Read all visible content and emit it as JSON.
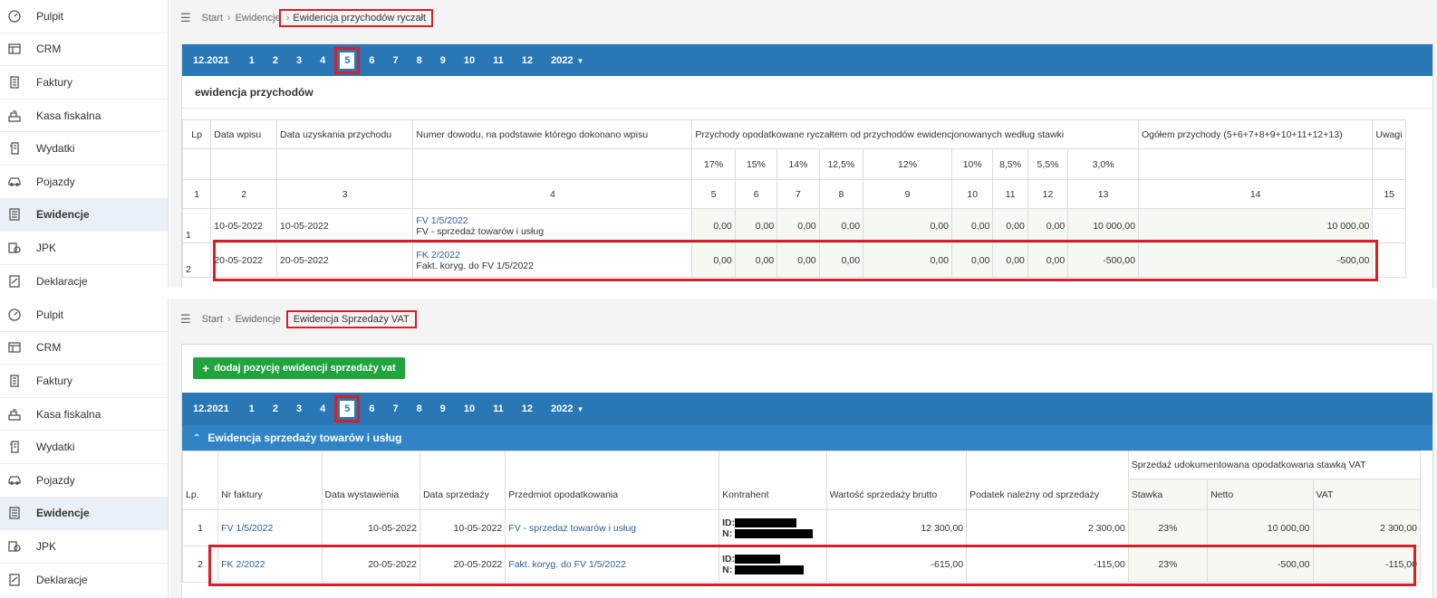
{
  "sidebar": {
    "items": [
      {
        "label": "Pulpit",
        "icon": "dashboard-icon"
      },
      {
        "label": "CRM",
        "icon": "crm-icon"
      },
      {
        "label": "Faktury",
        "icon": "invoice-icon"
      },
      {
        "label": "Kasa fiskalna",
        "icon": "cash-register-icon"
      },
      {
        "label": "Wydatki",
        "icon": "expenses-icon"
      },
      {
        "label": "Pojazdy",
        "icon": "car-icon"
      },
      {
        "label": "Ewidencje",
        "icon": "records-icon"
      },
      {
        "label": "JPK",
        "icon": "jpk-icon"
      },
      {
        "label": "Deklaracje",
        "icon": "declarations-icon"
      }
    ]
  },
  "top": {
    "breadcrumb": {
      "home": "Start",
      "parent": "Ewidencje",
      "current": "Ewidencja przychodów ryczałt"
    },
    "months": {
      "prev_year": "12.2021",
      "items": [
        "1",
        "2",
        "3",
        "4",
        "5",
        "6",
        "7",
        "8",
        "9",
        "10",
        "11",
        "12"
      ],
      "selected": "5",
      "year": "2022"
    },
    "section_title": "ewidencja przychodów",
    "table": {
      "headers": {
        "lp": "Lp",
        "data_wpisu": "Data wpisu",
        "data_uzyskania": "Data uzyskania przychodu",
        "numer_dowodu": "Numer dowodu, na podstawie którego dokonano wpisu",
        "przychody": "Przychody opodatkowane ryczałtem od przychodów ewidencjonowanych według stawki",
        "ogolem": "Ogółem przychody (5+6+7+8+9+10+11+12+13)",
        "uwagi": "Uwagi"
      },
      "rates": [
        "17%",
        "15%",
        "14%",
        "12,5%",
        "12%",
        "10%",
        "8,5%",
        "5,5%",
        "3,0%"
      ],
      "colnums": [
        "1",
        "2",
        "3",
        "4",
        "5",
        "6",
        "7",
        "8",
        "9",
        "10",
        "11",
        "12",
        "13",
        "14",
        "15"
      ],
      "rows": [
        {
          "lp": "1",
          "data_wpisu": "10-05-2022",
          "data_uzyskania": "10-05-2022",
          "doc_link": "FV 1/5/2022",
          "doc_desc": "FV - sprzedaż towarów i usług",
          "vals": [
            "0,00",
            "0,00",
            "0,00",
            "0,00",
            "0,00",
            "0,00",
            "0,00",
            "0,00",
            "10 000,00"
          ],
          "total": "10 000,00"
        },
        {
          "lp": "2",
          "data_wpisu": "20-05-2022",
          "data_uzyskania": "20-05-2022",
          "doc_link": "FK 2/2022",
          "doc_desc": "Fakt. koryg. do FV 1/5/2022",
          "vals": [
            "0,00",
            "0,00",
            "0,00",
            "0,00",
            "0,00",
            "0,00",
            "0,00",
            "0,00",
            "-500,00"
          ],
          "total": "-500,00"
        }
      ]
    }
  },
  "bottom": {
    "breadcrumb": {
      "home": "Start",
      "parent": "Ewidencje",
      "current": "Ewidencja Sprzedaży VAT"
    },
    "add_button": "dodaj pozycję ewidencji sprzedaży vat",
    "months": {
      "prev_year": "12.2021",
      "items": [
        "1",
        "2",
        "3",
        "4",
        "5",
        "6",
        "7",
        "8",
        "9",
        "10",
        "11",
        "12"
      ],
      "selected": "5",
      "year": "2022"
    },
    "group_title": "Ewidencja sprzedaży towarów i usług",
    "table": {
      "headers": {
        "lp": "Lp.",
        "nr_faktury": "Nr faktury",
        "data_wystawienia": "Data wystawienia",
        "data_sprzedazy": "Data sprzedaży",
        "przedmiot": "Przedmiot opodatkowania",
        "kontrahent": "Kontrahent",
        "wartosc": "Wartość sprzedaży brutto",
        "podatek": "Podatek należny od sprzedaży",
        "group": "Sprzedaż udokumentowana opodatkowana stawką VAT",
        "stawka": "Stawka",
        "netto": "Netto",
        "vat": "VAT"
      },
      "rows": [
        {
          "lp": "1",
          "nr": "FV 1/5/2022",
          "wystawienia": "10-05-2022",
          "sprzedazy": "10-05-2022",
          "przedmiot": "FV - sprzedaż towarów i usług",
          "id_label": "ID:",
          "n_label": "N:",
          "brutto": "12 300,00",
          "podatek": "2 300,00",
          "stawka": "23%",
          "netto": "10 000,00",
          "vat": "2 300,00"
        },
        {
          "lp": "2",
          "nr": "FK 2/2022",
          "wystawienia": "20-05-2022",
          "sprzedazy": "20-05-2022",
          "przedmiot": "Fakt. koryg. do FV 1/5/2022",
          "id_label": "ID:",
          "n_label": "N:",
          "brutto": "-615,00",
          "podatek": "-115,00",
          "stawka": "23%",
          "netto": "-500,00",
          "vat": "-115,00"
        }
      ]
    }
  },
  "colors": {
    "accent": "#2a77b6",
    "highlight": "#d61f26",
    "button": "#21a33e",
    "link": "#2c5f96"
  }
}
